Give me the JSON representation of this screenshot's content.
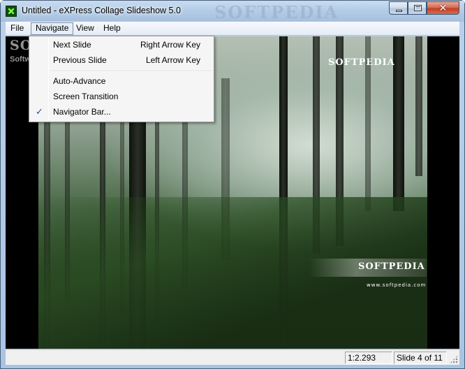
{
  "window": {
    "title": "Untitled - eXPress Collage Slideshow 5.0",
    "title_watermark": "SOFTPEDIA",
    "controls": {
      "minimize": "minimize",
      "maximize": "maximize",
      "close": "✕"
    }
  },
  "menubar": {
    "items": [
      {
        "label": "File",
        "active": false
      },
      {
        "label": "Navigate",
        "active": true
      },
      {
        "label": "View",
        "active": false
      },
      {
        "label": "Help",
        "active": false
      }
    ]
  },
  "navigate_menu": {
    "items": [
      {
        "label": "Next Slide",
        "shortcut": "Right Arrow Key",
        "checked": false
      },
      {
        "label": "Previous Slide",
        "shortcut": "Left Arrow Key",
        "checked": false
      },
      {
        "label": "Auto-Advance",
        "shortcut": "",
        "checked": false
      },
      {
        "label": "Screen Transition",
        "shortcut": "",
        "checked": false
      },
      {
        "label": "Navigator Bar...",
        "shortcut": "",
        "checked": true
      }
    ],
    "check_glyph": "✓"
  },
  "slide": {
    "watermark_top": "SOFTPEDIA",
    "watermark_corner": "SOFTPEDIA",
    "watermark_corner_sub": "Softw",
    "watermark_bottom": "SOFTPEDIA",
    "watermark_bottom_superscript": "®",
    "watermark_url": "www.softpedia.com"
  },
  "statusbar": {
    "zoom": "1:2.293",
    "slide_position": "Slide 4 of 11"
  },
  "colors": {
    "titlebar": "#b9d1ea",
    "menu_background": "#f5f5f5",
    "checkmark": "#1d4fa0",
    "content_background": "#000000"
  }
}
